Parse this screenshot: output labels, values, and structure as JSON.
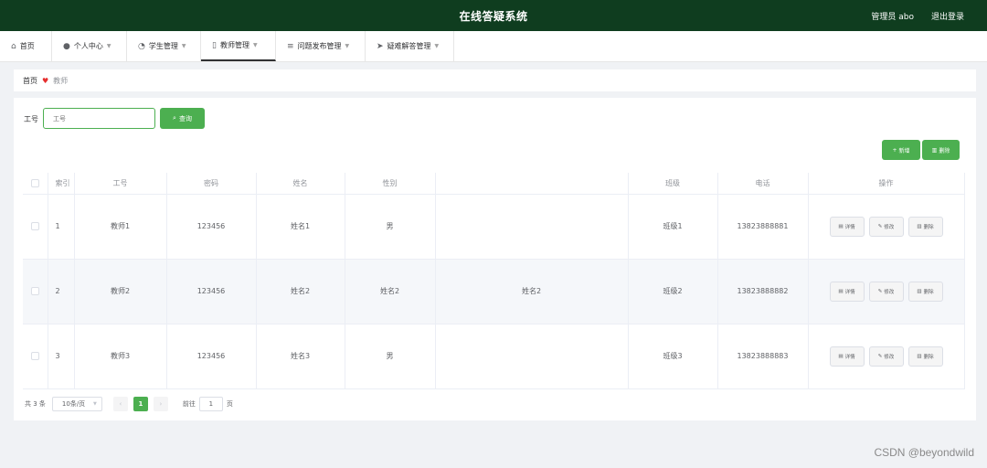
{
  "header": {
    "title": "在线答疑系统",
    "admin": "管理员 abo",
    "logout": "退出登录"
  },
  "nav": {
    "items": [
      {
        "label": "首页",
        "icon": "home-icon"
      },
      {
        "label": "个人中心",
        "icon": "user-icon"
      },
      {
        "label": "学生管理",
        "icon": "gauge-icon"
      },
      {
        "label": "教师管理",
        "icon": "phone-icon"
      },
      {
        "label": "问题发布管理",
        "icon": "list-icon"
      },
      {
        "label": "疑难解答管理",
        "icon": "send-icon"
      }
    ]
  },
  "breadcrumb": {
    "home": "首页",
    "current": "教师"
  },
  "search": {
    "label": "工号",
    "placeholder": "工号",
    "button": "查询"
  },
  "actions": {
    "add": "新增",
    "delete": "删除"
  },
  "table": {
    "headers": [
      "索引",
      "工号",
      "密码",
      "姓名",
      "性别",
      "",
      "班级",
      "电话",
      "操作"
    ],
    "rows": [
      {
        "index": "1",
        "id": "教师1",
        "password": "123456",
        "name": "姓名1",
        "gender": "男",
        "extra": "",
        "class": "班级1",
        "phone": "13823888881"
      },
      {
        "index": "2",
        "id": "教师2",
        "password": "123456",
        "name": "姓名2",
        "gender": "姓名2",
        "extra": "姓名2",
        "class": "班级2",
        "phone": "13823888882"
      },
      {
        "index": "3",
        "id": "教师3",
        "password": "123456",
        "name": "姓名3",
        "gender": "男",
        "extra": "",
        "class": "班级3",
        "phone": "13823888883"
      }
    ],
    "ops": {
      "detail": "详情",
      "edit": "修改",
      "delete": "删除"
    }
  },
  "pagination": {
    "total": "共 3 条",
    "page_size": "10条/页",
    "current": "1",
    "goto": "前往",
    "goto_value": "1",
    "page_suffix": "页"
  },
  "watermark": "CSDN @beyondwild",
  "colors": {
    "topbar": "#0f3d1f",
    "accent": "#4caf50"
  }
}
